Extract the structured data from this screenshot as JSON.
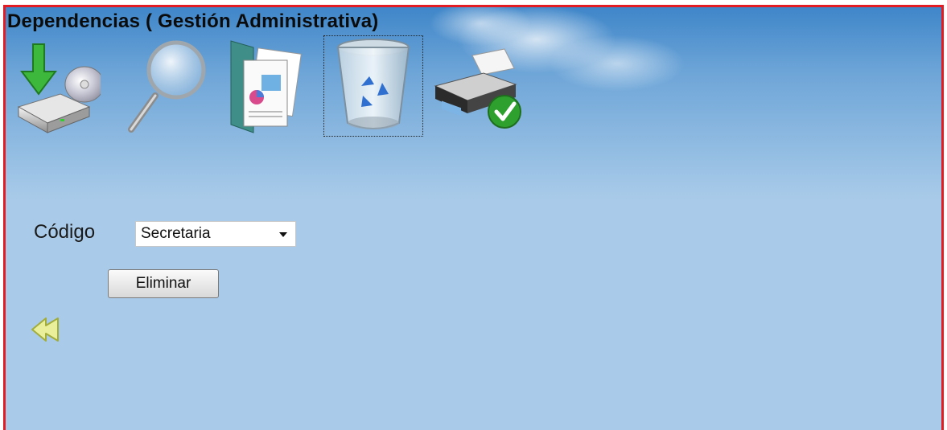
{
  "page": {
    "title": "Dependencias ( Gestión Administrativa)"
  },
  "toolbar": {
    "items": [
      {
        "icon": "save-disk-icon"
      },
      {
        "icon": "search-magnifier-icon"
      },
      {
        "icon": "documents-icon"
      },
      {
        "icon": "recycle-bin-icon",
        "focused": true
      },
      {
        "icon": "printer-check-icon"
      }
    ]
  },
  "form": {
    "codigo_label": "Código",
    "codigo_value": "Secretaria",
    "submit_label": "Eliminar"
  },
  "nav": {
    "back_icon": "rewind-back-icon"
  },
  "colors": {
    "frame_border": "#e31b23",
    "background": "#a9cbe9",
    "sky_top": "#3f86c9"
  }
}
